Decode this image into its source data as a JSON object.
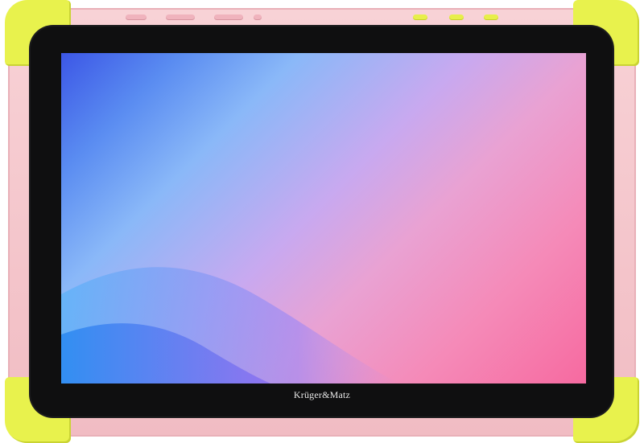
{
  "device": {
    "brand_label": "Krüger&Matz",
    "shell_color": "#f4c6cd",
    "bumper_color": "#e8f24d",
    "bezel_color": "#0f0f10"
  },
  "screen": {
    "wallpaper_colors": [
      "#3c57e6",
      "#8ab8f8",
      "#c8a9f0",
      "#f58ab8",
      "#f66aa0"
    ]
  }
}
